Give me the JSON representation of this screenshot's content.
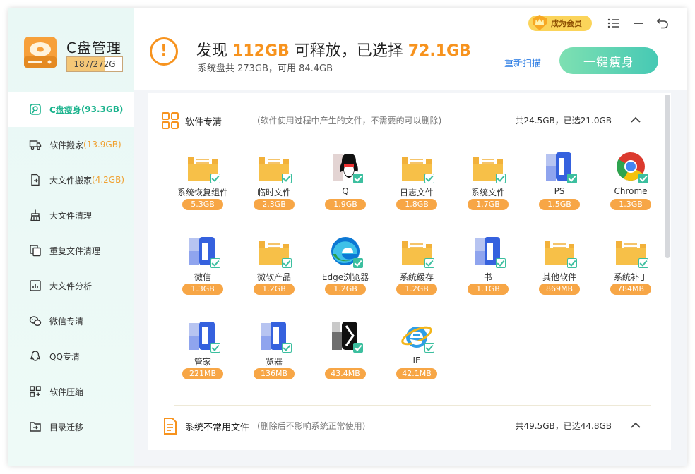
{
  "app": {
    "title": "C盘管理",
    "usage_text": "187/272G",
    "usage_fraction": 0.6875
  },
  "sidebar": {
    "items": [
      {
        "label": "C盘瘦身",
        "size": "(93.3GB)",
        "icon": "c-drive-icon"
      },
      {
        "label": "软件搬家",
        "size": "(13.9GB)",
        "icon": "truck-icon"
      },
      {
        "label": "大文件搬家",
        "size": "(4.2GB)",
        "icon": "file-move-icon"
      },
      {
        "label": "大文件清理",
        "size": "",
        "icon": "broom-icon"
      },
      {
        "label": "重复文件清理",
        "size": "",
        "icon": "duplicate-icon"
      },
      {
        "label": "大文件分析",
        "size": "",
        "icon": "chart-icon"
      },
      {
        "label": "微信专清",
        "size": "",
        "icon": "wechat-icon"
      },
      {
        "label": "QQ专清",
        "size": "",
        "icon": "qq-icon"
      },
      {
        "label": "软件压缩",
        "size": "",
        "icon": "compress-icon"
      },
      {
        "label": "目录迁移",
        "size": "",
        "icon": "folder-move-icon"
      }
    ]
  },
  "header": {
    "prefix": "发现",
    "found": "112GB",
    "middle": "可释放，已选择",
    "selected": "72.1GB",
    "subline": "系统盘共 273GB，可用 84.4GB",
    "rescan_label": "重新扫描",
    "slim_label": "一键瘦身",
    "vip_label": "成为会员"
  },
  "colors": {
    "accent_orange": "#f7931e",
    "accent_green": "#1bb38d",
    "size_pill": "#f7a646",
    "link_blue": "#2a7be3"
  },
  "sections": [
    {
      "title": "软件专清",
      "desc": "(软件使用过程中产生的文件，不需要的可以删除)",
      "stat": "共24.5GB，已选21.0GB"
    },
    {
      "title": "系统不常用文件",
      "desc": "(删除后不影响系统正常使用)",
      "stat": "共49.5GB，已选44.8GB"
    }
  ],
  "tiles": [
    {
      "name": "系统恢复组件",
      "size": "5.3GB",
      "icon": "folder"
    },
    {
      "name": "临时文件",
      "size": "2.3GB",
      "icon": "folder"
    },
    {
      "name": "Q",
      "size": "1.9GB",
      "icon": "blurred-qq"
    },
    {
      "name": "日志文件",
      "size": "1.8GB",
      "icon": "folder"
    },
    {
      "name": "系统文件",
      "size": "1.7GB",
      "icon": "folder"
    },
    {
      "name": "PS",
      "size": "1.5GB",
      "icon": "blurred-app"
    },
    {
      "name": "Chrome",
      "size": "1.3GB",
      "icon": "chrome"
    },
    {
      "name": "微信",
      "size": "1.3GB",
      "icon": "blurred-app"
    },
    {
      "name": "微软产品",
      "size": "1.2GB",
      "icon": "folder"
    },
    {
      "name": "Edge浏览器",
      "size": "1.2GB",
      "icon": "edge"
    },
    {
      "name": "系统缓存",
      "size": "1.2GB",
      "icon": "folder"
    },
    {
      "name": "书",
      "size": "1.1GB",
      "icon": "blurred-app"
    },
    {
      "name": "其他软件",
      "size": "869MB",
      "icon": "folder"
    },
    {
      "name": "系统补丁",
      "size": "784MB",
      "icon": "folder"
    },
    {
      "name": "管家",
      "size": "221MB",
      "icon": "blurred-app"
    },
    {
      "name": "览器",
      "size": "136MB",
      "icon": "blurred-app"
    },
    {
      "name": "",
      "size": "43.4MB",
      "icon": "blurred-dark"
    },
    {
      "name": "IE",
      "size": "42.1MB",
      "icon": "ie"
    }
  ]
}
